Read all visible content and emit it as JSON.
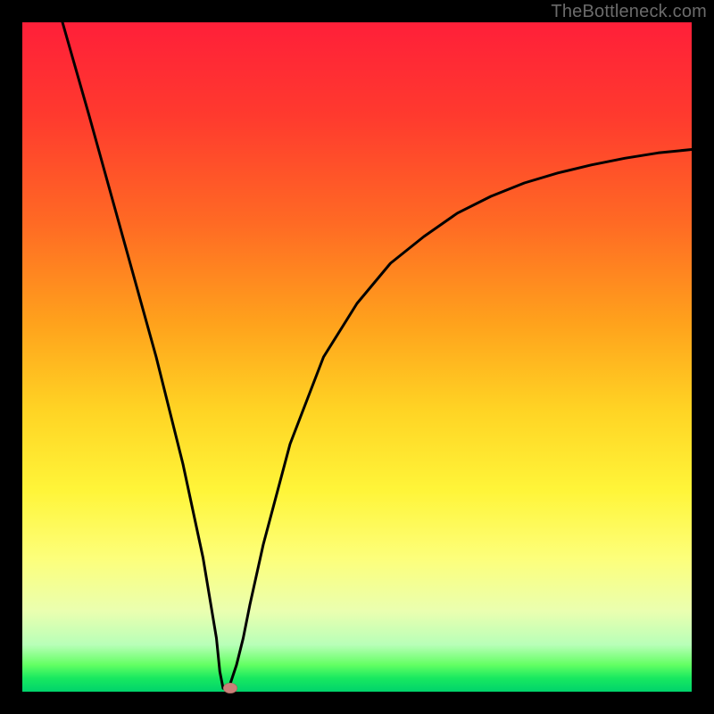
{
  "watermark": "TheBottleneck.com",
  "chart_data": {
    "type": "line",
    "title": "",
    "xlabel": "",
    "ylabel": "",
    "xlim": [
      0,
      100
    ],
    "ylim": [
      0,
      100
    ],
    "series": [
      {
        "name": "curve",
        "x": [
          6,
          10,
          15,
          20,
          24,
          27,
          29,
          29.5,
          30,
          30.5,
          31,
          32,
          33,
          34,
          36,
          40,
          45,
          50,
          55,
          60,
          65,
          70,
          75,
          80,
          85,
          90,
          95,
          100
        ],
        "y": [
          100,
          86,
          68,
          50,
          34,
          20,
          8,
          3,
          0.5,
          0.5,
          1,
          4,
          8,
          13,
          22,
          37,
          50,
          58,
          64,
          68,
          71.5,
          74,
          76,
          77.5,
          78.7,
          79.7,
          80.5,
          81
        ]
      }
    ],
    "marker": {
      "x": 31,
      "y": 0.5
    }
  },
  "colors": {
    "curve_stroke": "#000000",
    "marker_fill": "#c98079",
    "background_black": "#000000"
  }
}
